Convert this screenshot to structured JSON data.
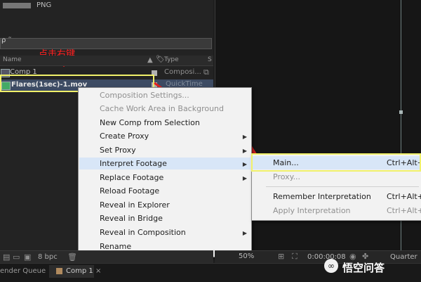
{
  "project": {
    "thumb_format": "PNG",
    "search_text": "ρ ˜",
    "columns": {
      "name": "Name",
      "type": "Type",
      "s": "S"
    },
    "items": [
      {
        "name": "Comp 1",
        "type": "Composi...",
        "label_color": "#b0b0b0"
      },
      {
        "name": "Flares(1sec)-1.mov",
        "type": "QuickTime",
        "label_color": "#b0b0b0"
      }
    ],
    "bpc": "8 bpc"
  },
  "annotation": {
    "text": "点击右键",
    "arrow": "↓"
  },
  "context_menu": {
    "items": [
      {
        "label": "Composition Settings...",
        "disabled": true,
        "submenu": false
      },
      {
        "label": "Cache Work Area in Background",
        "disabled": true,
        "submenu": false
      },
      {
        "label": "New Comp from Selection",
        "disabled": false,
        "submenu": false
      },
      {
        "label": "Create Proxy",
        "disabled": false,
        "submenu": true
      },
      {
        "label": "Set Proxy",
        "disabled": false,
        "submenu": true
      },
      {
        "label": "Interpret Footage",
        "disabled": false,
        "submenu": true,
        "highlighted": true
      },
      {
        "label": "Replace Footage",
        "disabled": false,
        "submenu": true
      },
      {
        "label": "Reload Footage",
        "disabled": false,
        "submenu": false
      },
      {
        "label": "Reveal in Explorer",
        "disabled": false,
        "submenu": false
      },
      {
        "label": "Reveal in Bridge",
        "disabled": false,
        "submenu": false
      },
      {
        "label": "Reveal in Composition",
        "disabled": false,
        "submenu": true
      },
      {
        "label": "Rename",
        "disabled": false,
        "submenu": false
      }
    ]
  },
  "submenu": {
    "items": [
      {
        "label": "Main...",
        "shortcut": "Ctrl+Alt+G",
        "disabled": false
      },
      {
        "label": "Proxy...",
        "shortcut": "",
        "disabled": true
      },
      {
        "label": "Remember Interpretation",
        "shortcut": "Ctrl+Alt+C",
        "disabled": false
      },
      {
        "label": "Apply Interpretation",
        "shortcut": "Ctrl+Alt+V",
        "disabled": true
      }
    ]
  },
  "viewer": {
    "zoom": "50%",
    "timecode": "0:00:00:08",
    "resolution": "Quarter"
  },
  "tabs": [
    {
      "label": "ender Queue",
      "active": false
    },
    {
      "label": "Comp 1",
      "active": true
    }
  ],
  "watermark": {
    "text": "悟空问答"
  },
  "colors": {
    "highlight_yellow": "#f1f16a",
    "arrow_red": "#e02020",
    "menu_bg": "#f2f2f2"
  }
}
